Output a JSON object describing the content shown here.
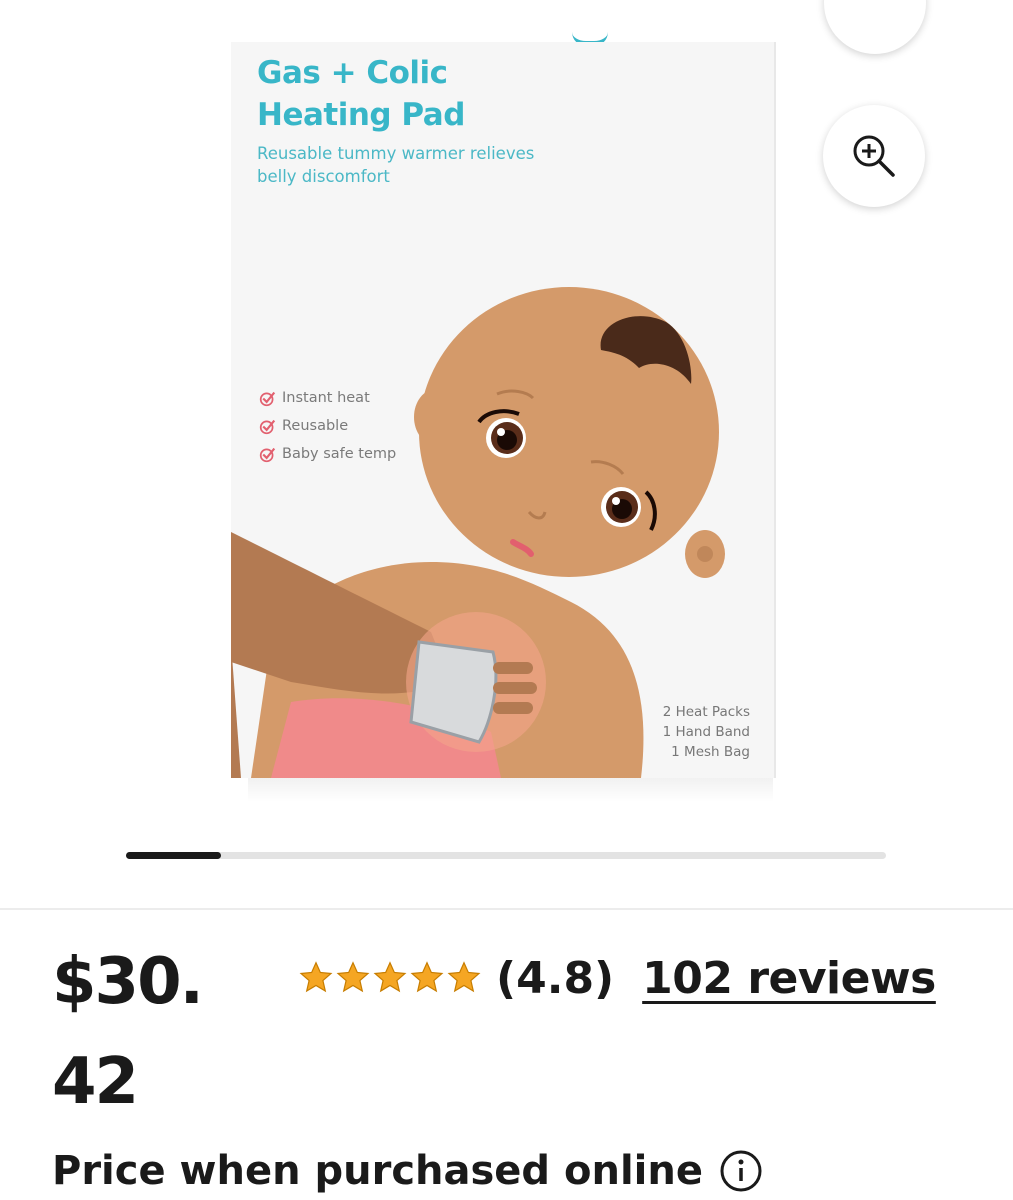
{
  "product_image": {
    "title": "Gas + Colic Heating Pad",
    "subtitle": "Reusable tummy warmer relieves belly discomfort",
    "features": [
      "Instant heat",
      "Reusable",
      "Baby safe temp"
    ],
    "contents": [
      "2 Heat Packs",
      "1 Hand Band",
      "1 Mesh Bag"
    ],
    "brand_color": "#38b6c8",
    "check_color": "#e2606f"
  },
  "actions": {
    "zoom_icon": "zoom-in-icon",
    "top_icon": "share-icon"
  },
  "carousel": {
    "current_index": 1,
    "total_images": 8,
    "progress_fraction": 0.125
  },
  "pricing": {
    "price": "$30.42",
    "price_note": "Price when purchased online",
    "info_icon": "info-icon"
  },
  "rating": {
    "stars": 5,
    "star_color": "#f5a623",
    "value_text": "(4.8)",
    "reviews_text": "102 reviews"
  }
}
